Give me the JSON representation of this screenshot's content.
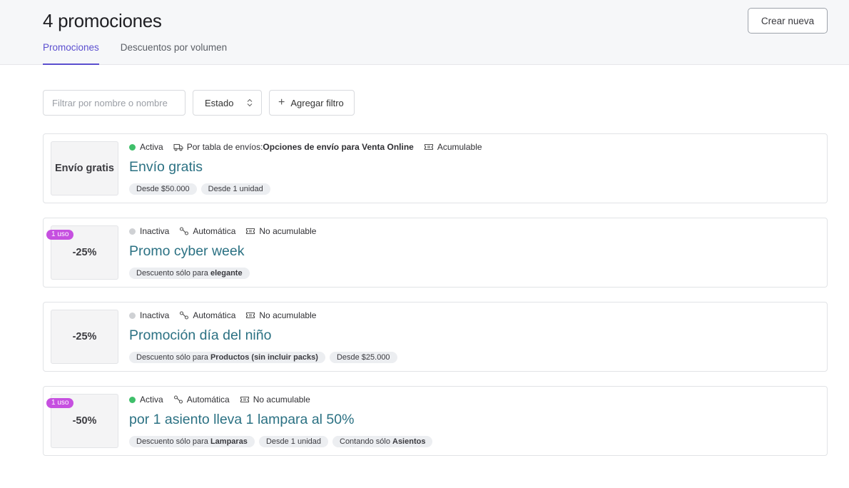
{
  "header": {
    "title": "4 promociones",
    "create_label": "Crear nueva",
    "tabs": [
      {
        "label": "Promociones",
        "active": true
      },
      {
        "label": "Descuentos por volumen",
        "active": false
      }
    ]
  },
  "filters": {
    "search_placeholder": "Filtrar por nombre o nombre",
    "status_label": "Estado",
    "add_filter_label": "Agregar filtro"
  },
  "colors": {
    "accent": "#5b4fcf",
    "active_dot": "#3fbf6a",
    "inactive_dot": "#cfd1d4",
    "uses_badge": "#c650e0",
    "title_link": "#2b7183"
  },
  "promotions": [
    {
      "thumb": "Envío gratis",
      "uses": "",
      "status": "Activa",
      "status_color": "#3fbf6a",
      "type_icon": "truck-icon",
      "type_prefix": "Por tabla de envíos: ",
      "type_bold": "Opciones de envío para Venta Online",
      "stack_label": "Acumulable",
      "title": "Envío gratis",
      "tags": [
        {
          "text": "Desde $50.000",
          "bold": ""
        },
        {
          "text": "Desde 1 unidad",
          "bold": ""
        }
      ]
    },
    {
      "thumb": "-25%",
      "uses": "1 uso",
      "status": "Inactiva",
      "status_color": "#cfd1d4",
      "type_icon": "automatic-icon",
      "type_prefix": "Automática",
      "type_bold": "",
      "stack_label": "No acumulable",
      "title": "Promo cyber week",
      "tags": [
        {
          "text": "Descuento sólo para ",
          "bold": "elegante"
        }
      ]
    },
    {
      "thumb": "-25%",
      "uses": "",
      "status": "Inactiva",
      "status_color": "#cfd1d4",
      "type_icon": "automatic-icon",
      "type_prefix": "Automática",
      "type_bold": "",
      "stack_label": "No acumulable",
      "title": "Promoción día del niño",
      "tags": [
        {
          "text": "Descuento sólo para ",
          "bold": "Productos (sin incluir packs)"
        },
        {
          "text": "Desde $25.000",
          "bold": ""
        }
      ]
    },
    {
      "thumb": "-50%",
      "uses": "1 uso",
      "status": "Activa",
      "status_color": "#3fbf6a",
      "type_icon": "automatic-icon",
      "type_prefix": "Automática",
      "type_bold": "",
      "stack_label": "No acumulable",
      "title": "por 1 asiento lleva 1 lampara al 50%",
      "tags": [
        {
          "text": "Descuento sólo para ",
          "bold": "Lamparas"
        },
        {
          "text": "Desde 1 unidad",
          "bold": ""
        },
        {
          "text": "Contando sólo ",
          "bold": "Asientos"
        }
      ]
    }
  ]
}
